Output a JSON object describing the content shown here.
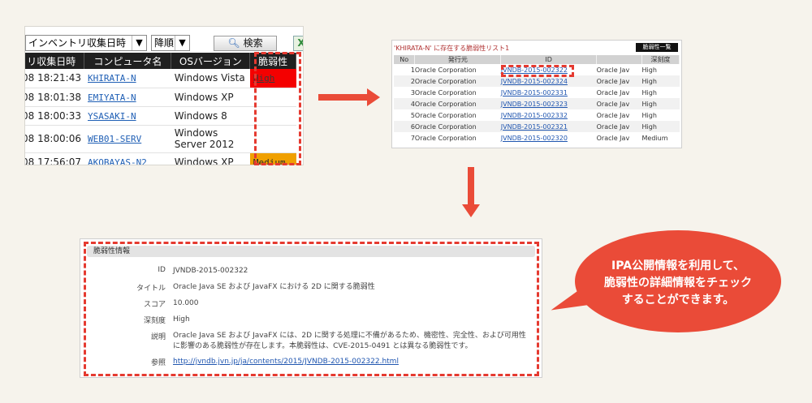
{
  "panel1": {
    "sort_select": "インベントリ収集日時",
    "order_select": "降順",
    "search_button": "検索",
    "export_icon": "X",
    "headers": [
      "リ収集日時",
      "コンピュータ名",
      "OSバージョン",
      "脆弱性"
    ],
    "rows": [
      {
        "date": "08 18:21:43",
        "pc": "KHIRATA-N",
        "os": "Windows Vista",
        "vul": "High",
        "level": "high"
      },
      {
        "date": "08 18:01:38",
        "pc": "EMIYATA-N",
        "os": "Windows XP",
        "vul": "",
        "level": "none"
      },
      {
        "date": "08 18:00:33",
        "pc": "YSASAKI-N",
        "os": "Windows 8",
        "vul": "",
        "level": "none"
      },
      {
        "date": "08 18:00:06",
        "pc": "WEB01-SERV",
        "os": "Windows Server 2012",
        "vul": "",
        "level": "none"
      },
      {
        "date": "08 17:56:07",
        "pc": "AKOBAYAS-N2",
        "os": "Windows XP",
        "vul": "Medium",
        "level": "medium"
      }
    ]
  },
  "panel2": {
    "title": "'KHIRATA-N' に存在する脆弱性リスト1",
    "tab": "脆弱性一覧",
    "headers": [
      "No",
      "発行元",
      "ID",
      "",
      "深刻度"
    ],
    "rows": [
      {
        "no": "1",
        "vendor": "Oracle Corporation",
        "id": "JVNDB-2015-002322",
        "prod": "Oracle Jav",
        "sev": "High"
      },
      {
        "no": "2",
        "vendor": "Oracle Corporation",
        "id": "JVNDB-2015-002324",
        "prod": "Oracle Jav",
        "sev": "High"
      },
      {
        "no": "3",
        "vendor": "Oracle Corporation",
        "id": "JVNDB-2015-002331",
        "prod": "Oracle Jav",
        "sev": "High"
      },
      {
        "no": "4",
        "vendor": "Oracle Corporation",
        "id": "JVNDB-2015-002323",
        "prod": "Oracle Jav",
        "sev": "High"
      },
      {
        "no": "5",
        "vendor": "Oracle Corporation",
        "id": "JVNDB-2015-002332",
        "prod": "Oracle Jav",
        "sev": "High"
      },
      {
        "no": "6",
        "vendor": "Oracle Corporation",
        "id": "JVNDB-2015-002321",
        "prod": "Oracle Jav",
        "sev": "High"
      },
      {
        "no": "7",
        "vendor": "Oracle Corporation",
        "id": "JVNDB-2015-002320",
        "prod": "Oracle Jav",
        "sev": "Medium"
      }
    ]
  },
  "panel3": {
    "header": "脆弱性情報",
    "fields": [
      {
        "label": "ID",
        "value": "JVNDB-2015-002322"
      },
      {
        "label": "タイトル",
        "value": "Oracle Java SE および JavaFX における 2D に関する脆弱性"
      },
      {
        "label": "スコア",
        "value": "10.000"
      },
      {
        "label": "深刻度",
        "value": "High"
      },
      {
        "label": "説明",
        "value": "Oracle Java SE および JavaFX には、2D に関する処理に不備があるため、機密性、完全性、および可用性に影響のある脆弱性が存在します。本脆弱性は、CVE-2015-0491 とは異なる脆弱性です。"
      },
      {
        "label": "参照",
        "value": "http://jvndb.jvn.jp/ja/contents/2015/JVNDB-2015-002322.html"
      }
    ]
  },
  "bubble": {
    "line1": "IPA公開情報を利用して、",
    "line2": "脆弱性の詳細情報をチェック",
    "line3": "することができます。"
  },
  "colors": {
    "accent": "#ea4b38",
    "high": "#f40000",
    "medium": "#f0a000",
    "link": "#1f5fb5"
  }
}
